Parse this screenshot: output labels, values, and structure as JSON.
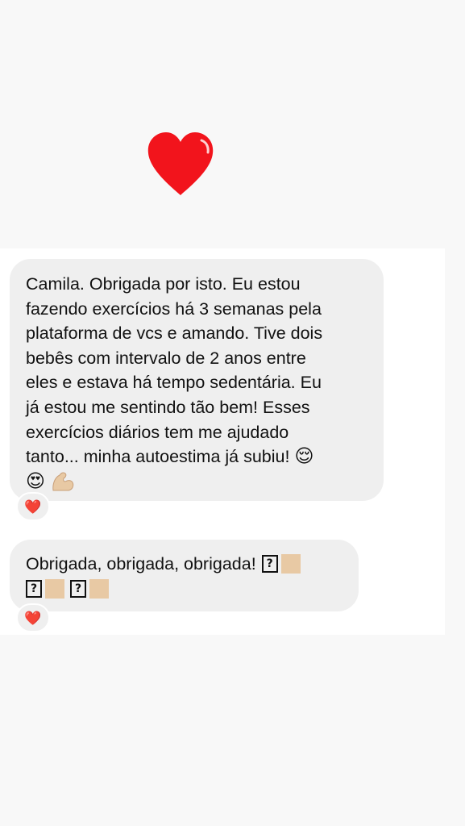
{
  "colors": {
    "page_background": "#f8f8f8",
    "chat_background": "#ffffff",
    "bubble_background": "#efefef",
    "heart_red": "#f2141c",
    "skin_tone": "#e8c9a4"
  },
  "header": {
    "heart_icon": "red-heart-icon"
  },
  "messages": [
    {
      "lines": [
        "Camila. Obrigada por isto. Eu estou",
        "fazendo exercícios há 3 semanas pela",
        "plataforma de vcs e amando. Tive dois",
        "bebês com intervalo de 2 anos entre",
        "eles e estava há tempo sedentária. Eu",
        "já estou me sentindo tão bem! Esses",
        "exercícios diários tem me ajudado",
        "tanto... minha autoestima já subiu!"
      ],
      "emoji_inline": "😌",
      "emoji_row": [
        "😍",
        "💪"
      ],
      "reaction": "❤️"
    },
    {
      "line1": "Obrigada, obrigada, obrigada!",
      "missing_glyph": "?",
      "reaction": "❤️"
    }
  ]
}
